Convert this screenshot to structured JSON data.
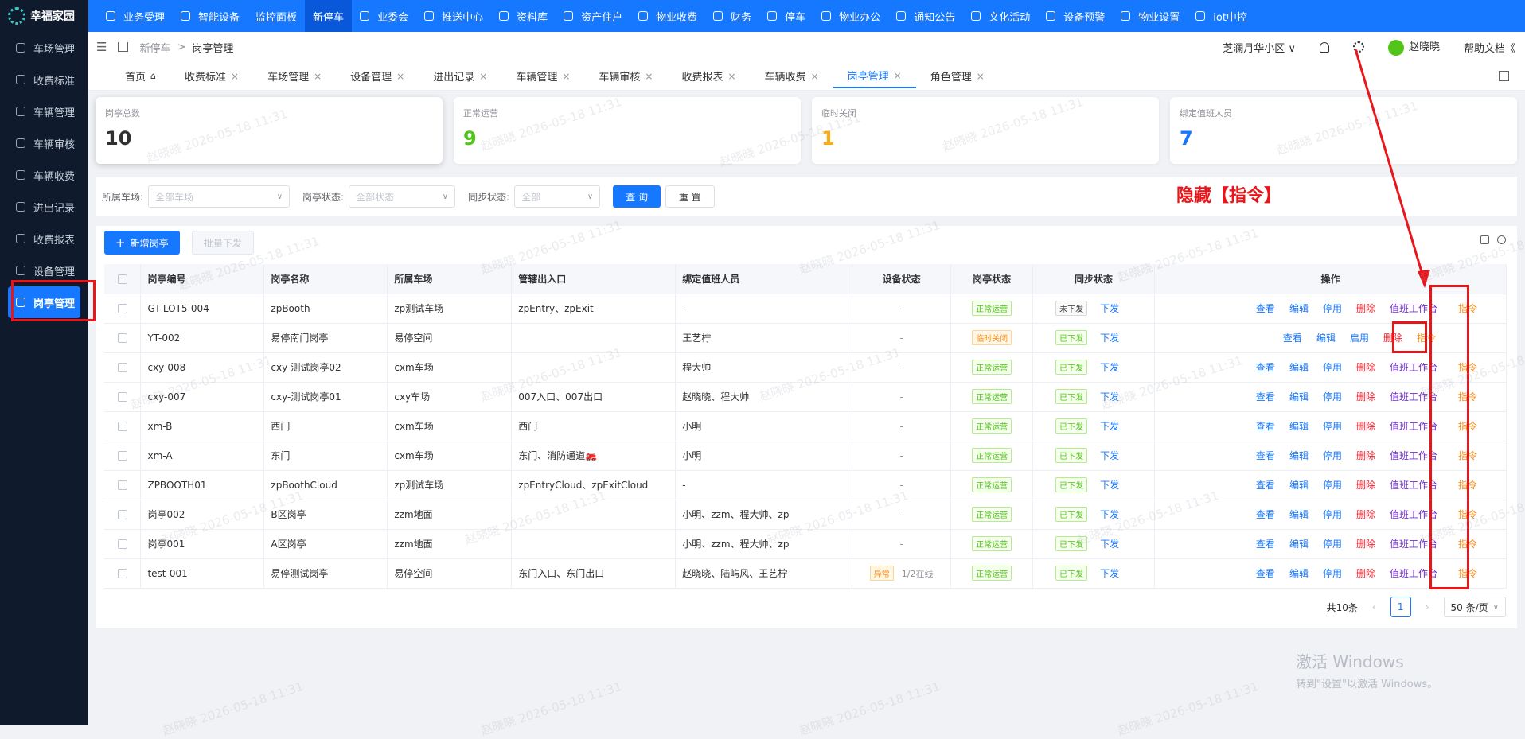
{
  "app": {
    "name": "幸福家园"
  },
  "sidebar": {
    "items": [
      {
        "label": "车场管理"
      },
      {
        "label": "收费标准"
      },
      {
        "label": "车辆管理"
      },
      {
        "label": "车辆审核"
      },
      {
        "label": "车辆收费"
      },
      {
        "label": "进出记录"
      },
      {
        "label": "收费报表"
      },
      {
        "label": "设备管理"
      },
      {
        "label": "岗亭管理"
      }
    ]
  },
  "topnav": {
    "items": [
      {
        "label": "业务受理"
      },
      {
        "label": "智能设备"
      },
      {
        "label": "监控面板"
      },
      {
        "label": "新停车"
      },
      {
        "label": "业委会"
      },
      {
        "label": "推送中心"
      },
      {
        "label": "资料库"
      },
      {
        "label": "资产住户"
      },
      {
        "label": "物业收费"
      },
      {
        "label": "财务"
      },
      {
        "label": "停车"
      },
      {
        "label": "物业办公"
      },
      {
        "label": "通知公告"
      },
      {
        "label": "文化活动"
      },
      {
        "label": "设备预警"
      },
      {
        "label": "物业设置"
      },
      {
        "label": "iot中控"
      }
    ]
  },
  "breadcrumb": {
    "parent": "新停车",
    "sep": ">",
    "current": "岗亭管理"
  },
  "header": {
    "community": "芝澜月华小区",
    "community_chevron": "∨",
    "user": "赵晓晓",
    "help": "帮助文档",
    "help_arrows": "《"
  },
  "tabs": [
    {
      "label": "首页"
    },
    {
      "label": "收费标准"
    },
    {
      "label": "车场管理"
    },
    {
      "label": "设备管理"
    },
    {
      "label": "进出记录"
    },
    {
      "label": "车辆管理"
    },
    {
      "label": "车辆审核"
    },
    {
      "label": "收费报表"
    },
    {
      "label": "车辆收费"
    },
    {
      "label": "岗亭管理"
    },
    {
      "label": "角色管理"
    }
  ],
  "tab_close": "×",
  "stats": [
    {
      "label": "岗亭总数",
      "value": "10",
      "color": "#303133"
    },
    {
      "label": "正常运营",
      "value": "9",
      "color": "#52c41a"
    },
    {
      "label": "临时关闭",
      "value": "1",
      "color": "#faad14"
    },
    {
      "label": "绑定值班人员",
      "value": "7",
      "color": "#1677ff"
    }
  ],
  "filters": {
    "parking_label": "所属车场:",
    "parking_placeholder": "全部车场",
    "status_label": "岗亭状态:",
    "status_placeholder": "全部状态",
    "sync_label": "同步状态:",
    "sync_placeholder": "全部",
    "query": "查 询",
    "reset": "重 置"
  },
  "annotation": "隐藏【指令】",
  "toolbar": {
    "add": "新增岗亭",
    "batch": "批量下发"
  },
  "table": {
    "headers": [
      "岗亭编号",
      "岗亭名称",
      "所属车场",
      "管辖出入口",
      "绑定值班人员",
      "设备状态",
      "岗亭状态",
      "同步状态",
      "操作"
    ],
    "rows": [
      {
        "code": "GT-LOT5-004",
        "name": "zpBooth",
        "lot": "zp测试车场",
        "gates": "zpEntry、zpExit",
        "staff": "-",
        "device": "-",
        "status": "正常运营",
        "sync": "未下发",
        "sync_link": "下发"
      },
      {
        "code": "YT-002",
        "name": "易停南门岗亭",
        "lot": "易停空间",
        "gates": "",
        "staff": "王艺柠",
        "device": "-",
        "status": "临时关闭",
        "sync": "已下发",
        "sync_link": "下发"
      },
      {
        "code": "cxy-008",
        "name": "cxy-测试岗亭02",
        "lot": "cxm车场",
        "gates": "",
        "staff": "程大帅",
        "device": "-",
        "status": "正常运营",
        "sync": "已下发",
        "sync_link": "下发"
      },
      {
        "code": "cxy-007",
        "name": "cxy-测试岗亭01",
        "lot": "cxy车场",
        "gates": "007入口、007出口",
        "staff": "赵晓晓、程大帅",
        "device": "-",
        "status": "正常运营",
        "sync": "已下发",
        "sync_link": "下发"
      },
      {
        "code": "xm-B",
        "name": "西门",
        "lot": "cxm车场",
        "gates": "西门",
        "staff": "小明",
        "device": "-",
        "status": "正常运营",
        "sync": "已下发",
        "sync_link": "下发"
      },
      {
        "code": "xm-A",
        "name": "东门",
        "lot": "cxm车场",
        "gates": "东门、消防通道🚒",
        "staff": "小明",
        "device": "-",
        "status": "正常运营",
        "sync": "已下发",
        "sync_link": "下发"
      },
      {
        "code": "ZPBOOTH01",
        "name": "zpBoothCloud",
        "lot": "zp测试车场",
        "gates": "zpEntryCloud、zpExitCloud",
        "staff": "-",
        "device": "-",
        "status": "正常运营",
        "sync": "已下发",
        "sync_link": "下发"
      },
      {
        "code": "岗亭002",
        "name": "B区岗亭",
        "lot": "zzm地面",
        "gates": "",
        "staff": "小明、zzm、程大帅、zp",
        "device": "-",
        "status": "正常运营",
        "sync": "已下发",
        "sync_link": "下发"
      },
      {
        "code": "岗亭001",
        "name": "A区岗亭",
        "lot": "zzm地面",
        "gates": "",
        "staff": "小明、zzm、程大帅、zp",
        "device": "-",
        "status": "正常运营",
        "sync": "已下发",
        "sync_link": "下发"
      },
      {
        "code": "test-001",
        "name": "易停测试岗亭",
        "lot": "易停空间",
        "gates": "东门入口、东门出口",
        "staff": "赵晓晓、陆屿风、王艺柠",
        "device": "异常",
        "device_extra": "1/2在线",
        "status": "正常运营",
        "sync": "已下发",
        "sync_link": "下发"
      }
    ],
    "ops": {
      "view": "查看",
      "edit": "编辑",
      "disable": "停用",
      "enable": "启用",
      "delete": "删除",
      "dispatch": "值班工作台",
      "cmd": "指令"
    }
  },
  "pagination": {
    "total": "共10条",
    "prev": "‹",
    "page": "1",
    "next": "›",
    "size": "50 条/页",
    "size_chevron": "∨"
  },
  "windows": {
    "line1": "激活 Windows",
    "line2": "转到\"设置\"以激活 Windows。"
  },
  "watermark": "赵晓晓 2026-05-18 11:31",
  "colors": {
    "primary": "#1677ff",
    "sidebar": "#0f1b2d",
    "annotation": "#e8161b",
    "success": "#52c41a",
    "warning": "#faad14"
  }
}
